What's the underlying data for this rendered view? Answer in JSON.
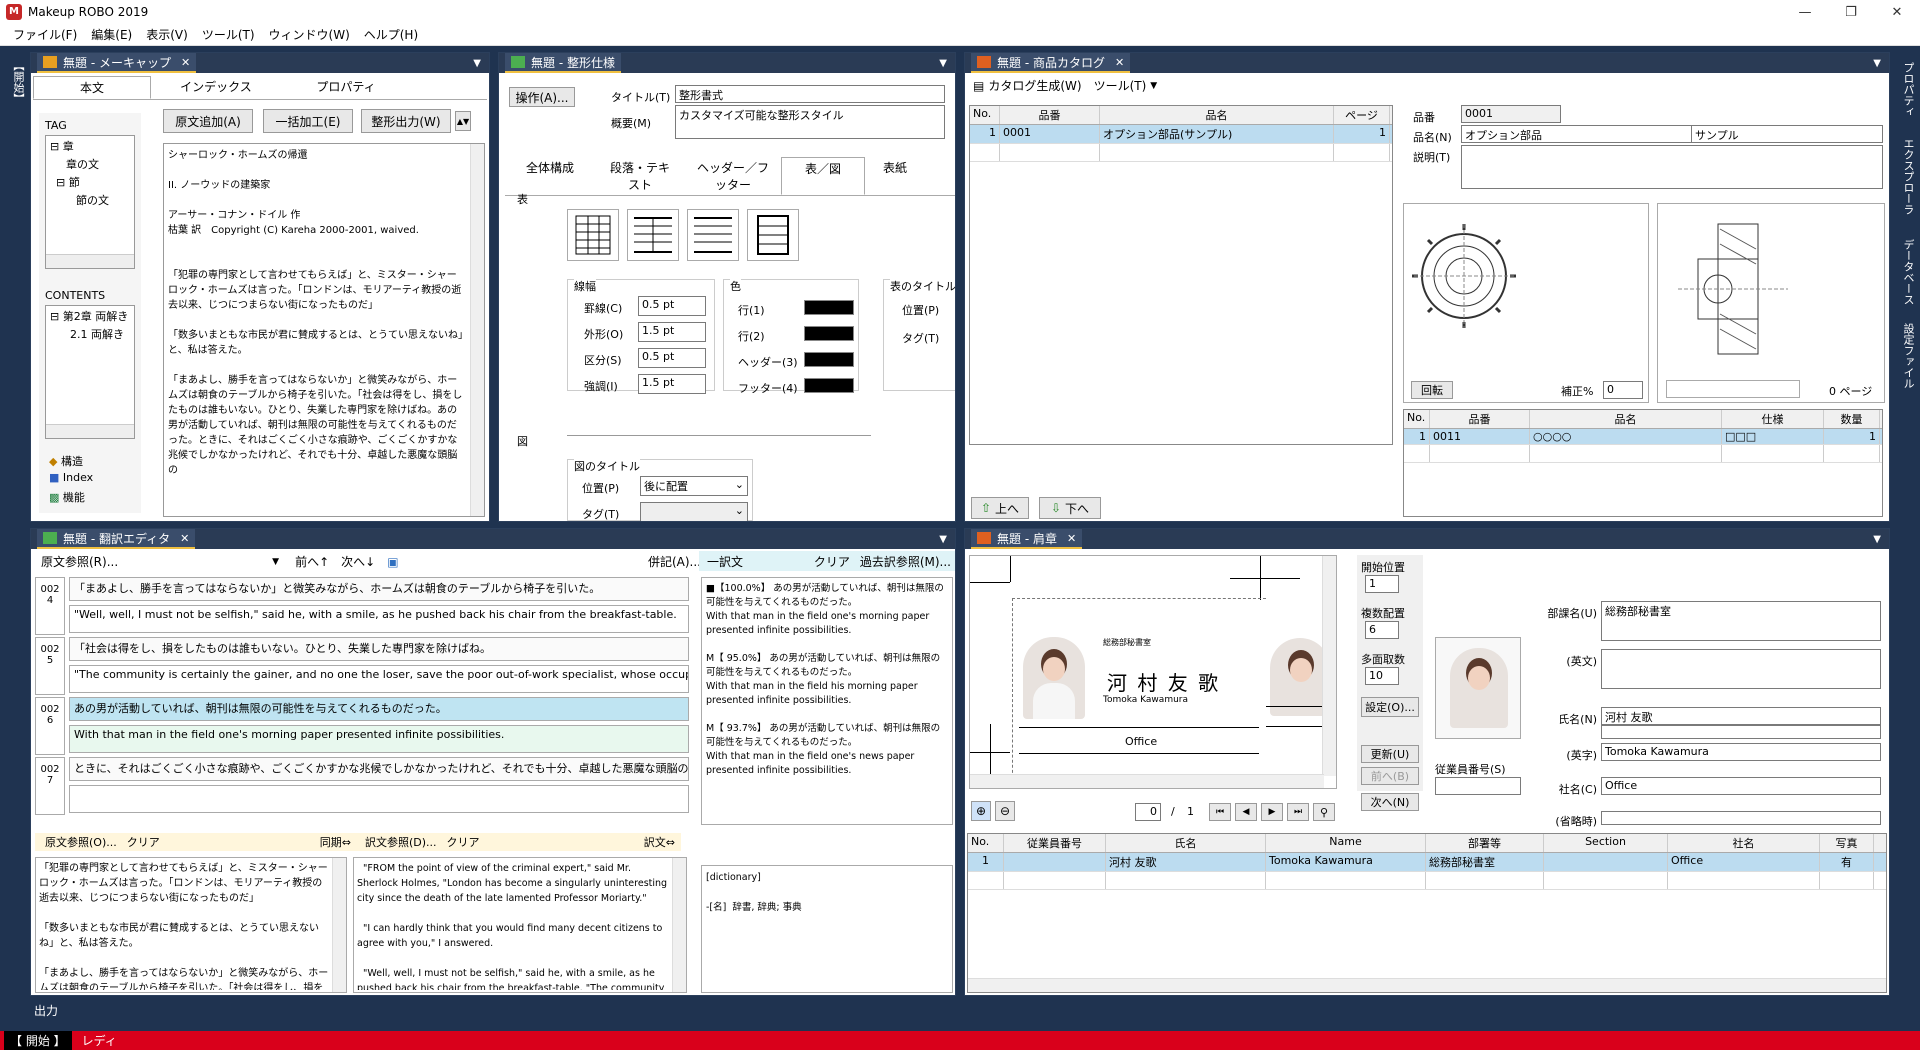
{
  "app": {
    "title": "Makeup ROBO 2019"
  },
  "menu": [
    "ファイル(F)",
    "編集(E)",
    "表示(V)",
    "ツール(T)",
    "ウィンドウ(W)",
    "ヘルプ(H)"
  ],
  "left_side_tab": "【開始】",
  "right_side_tabs": [
    "プロパティ",
    "エクスプローラ",
    "データベース",
    "設定ファイル"
  ],
  "makecap": {
    "title": "無題 - メーキャップ",
    "tabs": [
      "本文",
      "インデックス",
      "プロパティ"
    ],
    "buttons": [
      "原文追加(A)",
      "一括加工(E)",
      "整形出力(W)"
    ],
    "tag_label": "TAG",
    "tag_tree": [
      "章",
      "章の文",
      "節",
      "節の文"
    ],
    "contents_label": "CONTENTS",
    "contents_tree": [
      "第2章 両解き",
      "2.1 両解き"
    ],
    "nav": [
      "構造",
      "Index",
      "機能"
    ],
    "body_text": "シャーロック・ホームズの帰還\n\nII. ノーウッドの建築家\n\nアーサー・コナン・ドイル 作\n枯葉 訳　Copyright (C) Kareha 2000-2001, waived.\n\n\n「犯罪の専門家として言わせてもらえば」と、ミスター・シャーロック・ホームズは言った。「ロンドンは、モリアーティ教授の逝去以来、じつにつまらない街になったものだ」\n\n「数多いまともな市民が君に賛成するとは、とうてい思えないね」と、私は答えた。\n\n「まあよし、勝手を言ってはならないか」と微笑みながら、ホームズは朝食のテーブルから椅子を引いた。「社会は得をし、損をしたものは誰もいない。ひとり、失業した専門家を除けばね。あの男が活動していれば、朝刊は無限の可能性を与えてくれるものだった。ときに、それはごくごく小さな痕跡や、ごくごくかすかな兆候でしかなかったけれど、それでも十分、卓越した悪魔な頭脳の"
  },
  "seikei": {
    "title": "無題 - 整形仕様",
    "op_button": "操作(A)...",
    "title_label": "タイトル(T)",
    "title_value": "整形書式",
    "summary_label": "概要(M)",
    "summary_value": "カスタマイズ可能な整形スタイル",
    "tabs": [
      "全体構成",
      "段落・テキスト",
      "ヘッダー／フッター",
      "表／図",
      "表紙"
    ],
    "table_label": "表",
    "linewidth_label": "線幅",
    "lines": [
      {
        "label": "罫線(C)",
        "value": "0.5 pt"
      },
      {
        "label": "外形(O)",
        "value": "1.5 pt"
      },
      {
        "label": "区分(S)",
        "value": "0.5 pt"
      },
      {
        "label": "強調(I)",
        "value": "1.5 pt"
      }
    ],
    "color_label": "色",
    "colors": [
      "行(1)",
      "行(2)",
      "ヘッダー(3)",
      "フッター(4)"
    ],
    "table_title_label": "表のタイトル",
    "position_p": "位置(P)",
    "tag_t": "タグ(T)",
    "fig_label": "図",
    "fig_title_label": "図のタイトル",
    "fig_position_label": "位置(P)",
    "fig_position_value": "後に配置",
    "fig_tag_label": "タグ(T)"
  },
  "catalog": {
    "title": "無題 - 商品カタログ",
    "toolbar": [
      "カタログ生成(W)",
      "ツール(T)"
    ],
    "list_headers": [
      "No.",
      "品番",
      "品名",
      "ページ"
    ],
    "list_rows": [
      {
        "no": "1",
        "code": "0001",
        "name": "オプション部品(サンプル)",
        "page": "1"
      }
    ],
    "code_label": "品番",
    "code_value": "0001",
    "name_label": "品名(N)",
    "name_value1": "オプション部品",
    "name_value2": "サンプル",
    "desc_label": "説明(T)",
    "rotate_button": "回転",
    "correction_label": "補正%",
    "correction_value": "0",
    "page_label": "0 ページ",
    "parts_headers": [
      "No.",
      "品番",
      "品名",
      "仕様",
      "数量"
    ],
    "parts_rows": [
      {
        "no": "1",
        "code": "0011",
        "name": "○○○○",
        "spec": "□□□",
        "qty": "1"
      }
    ],
    "up_button": "上へ",
    "down_button": "下へ"
  },
  "translate": {
    "title": "無題 - 翻訳エディタ",
    "toolbar_left": [
      "原文参照(R)...",
      "前へ↑",
      "次へ↓"
    ],
    "toolbar_right": [
      "併記(A)...",
      "一訳文",
      "クリア",
      "過去訳参照(M)..."
    ],
    "segments": [
      {
        "no": "002\n4",
        "src": "「まあよし、勝手を言ってはならないか」と微笑みながら、ホームズは朝食のテーブルから椅子を引いた。",
        "tgt": "\"Well, well, I must not be selfish,\" said he, with a smile, as he pushed back his chair from the breakfast-table."
      },
      {
        "no": "002\n5",
        "src": "「社会は得をし、損をしたものは誰もいない。ひとり、失業した専門家を除けばね。",
        "tgt": "\"The community is certainly the gainer, and no one the loser, save the poor out-of-work specialist, whose occupation has gone."
      },
      {
        "no": "002\n6",
        "src": "あの男が活動していれば、朝刊は無限の可能性を与えてくれるものだった。",
        "tgt": "With that man in the field one's morning paper presented infinite possibilities."
      },
      {
        "no": "002\n7",
        "src": "ときに、それはごくごく小さな痕跡や、ごくごくかすかな兆候でしかなかったけれど、それでも十分、卓越した悪魔な頭脳の存在を僕に知らせてくれた。",
        "tgt": ""
      }
    ],
    "memory": "■【100.0%】 あの男が活動していれば、朝刊は無限の可能性を与えてくれるものだった。\nWith that man in the field one's morning paper presented infinite possibilities.\n\nM【 95.0%】 あの男が活動していれば、朝刊は無限の可能性を与えてくれるものだった。\nWith that man in the field his morning paper presented infinite possibilities.\n\nM【 93.7%】 あの男が活動していれば、朝刊は無限の可能性を与えてくれるものだった。\nWith that man in the field one's news paper presented infinite possibilities.",
    "src_ref_bar": [
      "原文参照(O)...",
      "クリア",
      "同期⇔"
    ],
    "tgt_ref_bar": [
      "訳文参照(D)...",
      "クリア",
      "訳文⇔"
    ],
    "src_ref_text": "「犯罪の専門家として言わせてもらえば」と、ミスター・シャーロック・ホームズは言った。「ロンドンは、モリアーティ教授の逝去以来、じつにつまらない街になったものだ」\n\n「数多いまともな市民が君に賛成するとは、とうてい思えないね」と、私は答えた。\n\n「まあよし、勝手を言ってはならないか」と微笑みながら、ホームズは朝食のテーブルから椅子を引いた。「社会は得をし、損を",
    "tgt_ref_text": "  \"FROM the point of view of the criminal expert,\" said Mr. Sherlock Holmes, \"London has become a singularly uninteresting city since the death of the late lamented Professor Moriarty.\"\n\n  \"I can hardly think that you would find many decent citizens to agree with you,\" I answered.\n\n  \"Well, well, I must not be selfish,\" said he, with a smile, as he pushed back his chair from the breakfast-table. \"The community is",
    "dict_text": "[dictionary]\n\n-[名]  辞書, 辞典; 事典"
  },
  "namecard": {
    "title": "無題 - 肩章",
    "card_dept": "総務部秘書室",
    "card_name": "河 村 友 歌",
    "card_roman": "Tomoka Kawamura",
    "card_company": "Office",
    "start_pos_label": "開始位置",
    "start_pos_value": "1",
    "copies_label": "複数配置",
    "copies_value": "6",
    "faces_label": "多面取数",
    "faces_value": "10",
    "settings_button": "設定(O)...",
    "update_button": "更新(U)",
    "prev_button": "前へ(B)",
    "next_button": "次へ(N)",
    "page_current": "0",
    "page_sep": "/",
    "page_total": "1",
    "emp_no_label": "従業員番号(S)",
    "dept_label": "部課名(U)",
    "dept_value": "総務部秘書室",
    "dept_en_label": "(英文)",
    "name_label": "氏名(N)",
    "name_value": "河村 友歌",
    "name_en_label": "(英字)",
    "name_en_value": "Tomoka Kawamura",
    "company_label": "社名(C)",
    "company_value": "Office",
    "abbr_label": "(省略時)",
    "list_headers": [
      "No.",
      "従業員番号",
      "氏名",
      "Name",
      "部署等",
      "Section",
      "社名",
      "写真"
    ],
    "list_rows": [
      {
        "no": "1",
        "emp": "",
        "name": "河村 友歌",
        "en": "Tomoka Kawamura",
        "dept": "総務部秘書室",
        "section": "",
        "company": "Office",
        "photo": "有"
      }
    ]
  },
  "output_label": "出力",
  "status": {
    "mode": "【 開始 】",
    "text": "レディ"
  },
  "colors": {
    "accent_status": "#d9001b",
    "panel_title": "#2a3b55",
    "selection": "#bcdcf0"
  }
}
